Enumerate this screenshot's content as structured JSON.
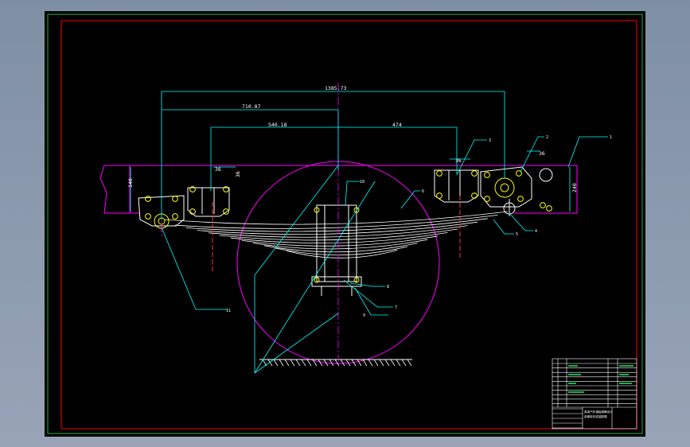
{
  "drawing": {
    "dimensions": {
      "overall": "1385.73",
      "left_half": "710.87",
      "inner_left": "540.18",
      "inner_right": "474",
      "front_bracket_height": "140",
      "rear_bracket_height": "240",
      "small_a": "36",
      "small_b": "36",
      "small_c": "36",
      "small_d": "36"
    },
    "balloons": [
      "1",
      "2",
      "3",
      "4",
      "5",
      "6",
      "7",
      "8",
      "9",
      "10",
      "11"
    ],
    "title_block": {
      "title_line1": "某某汽车钢板弹簧设计",
      "title_line2": "前悬架总成装配图"
    },
    "colors": {
      "frame_outer": "#22b14c",
      "frame_inner": "#ff0000",
      "part_outline": "#ffffff",
      "dimension": "#00ffff",
      "centerline": "#ff00ff",
      "bolt": "#ffff00",
      "hidden": "#ff3333"
    }
  }
}
